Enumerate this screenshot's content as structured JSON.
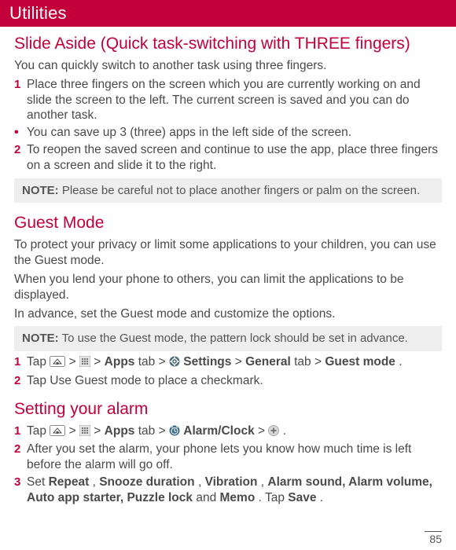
{
  "header": {
    "title": "Utilities"
  },
  "slide_aside": {
    "title": "Slide Aside (Quick task-switching with THREE fingers)",
    "intro": "You can quickly switch to another task using three fingers.",
    "steps": [
      {
        "marker": "1",
        "text": "Place three fingers on the screen which you are currently working on and slide the screen to the left. The current screen is saved and you can do another task."
      },
      {
        "marker": "•",
        "text": "You can save up 3 (three) apps in the left side of the screen."
      },
      {
        "marker": "2",
        "text": "To reopen the saved screen and continue to use the app, place three fingers on a screen and slide it to the right."
      }
    ],
    "note_label": "NOTE:",
    "note_text": " Please be careful not to place another fingers or palm on the screen."
  },
  "guest_mode": {
    "title": "Guest Mode",
    "p1": "To protect your privacy or limit some applications to your children, you can use the Guest mode.",
    "p2": "When you lend your phone to others, you can limit the applications to be displayed.",
    "p3": "In advance, set the Guest mode and customize the options.",
    "note_label": "NOTE:",
    "note_text": " To use the Guest mode, the pattern lock should be set in advance.",
    "steps": [
      {
        "marker": "1",
        "parts": {
          "t0": "Tap ",
          "t1": " > ",
          "t2": " > ",
          "apps_bold": "Apps",
          "t3": " tab > ",
          "t4": " ",
          "settings_bold": "Settings",
          "t5": " > ",
          "general_bold": "General",
          "t6": " tab > ",
          "guest_bold": "Guest mode",
          "t7": "."
        }
      },
      {
        "marker": "2",
        "text": "Tap Use Guest mode to place a checkmark."
      }
    ]
  },
  "alarm": {
    "title": "Setting your alarm",
    "steps": [
      {
        "marker": "1",
        "parts": {
          "t0": "Tap ",
          "t1": " > ",
          "t2": " > ",
          "apps_bold": "Apps",
          "t3": " tab > ",
          "t4": " ",
          "alarm_bold": "Alarm/Clock",
          "t5": " > ",
          "t6": "."
        }
      },
      {
        "marker": "2",
        "text": "After you set the alarm, your phone lets you know how much time is left before the alarm will go off."
      },
      {
        "marker": "3",
        "parts": {
          "t0": "Set ",
          "repeat_b": "Repeat",
          "c1": ", ",
          "snooze_b": "Snooze duration",
          "c2": ", ",
          "vib_b": "Vibration",
          "c3": ", ",
          "sound_b": "Alarm sound, Alarm volume, Auto app starter, Puzzle lock",
          "and": " and ",
          "memo_b": "Memo",
          "t1": ". Tap ",
          "save_b": "Save",
          "t2": "."
        }
      }
    ]
  },
  "page_number": "85"
}
